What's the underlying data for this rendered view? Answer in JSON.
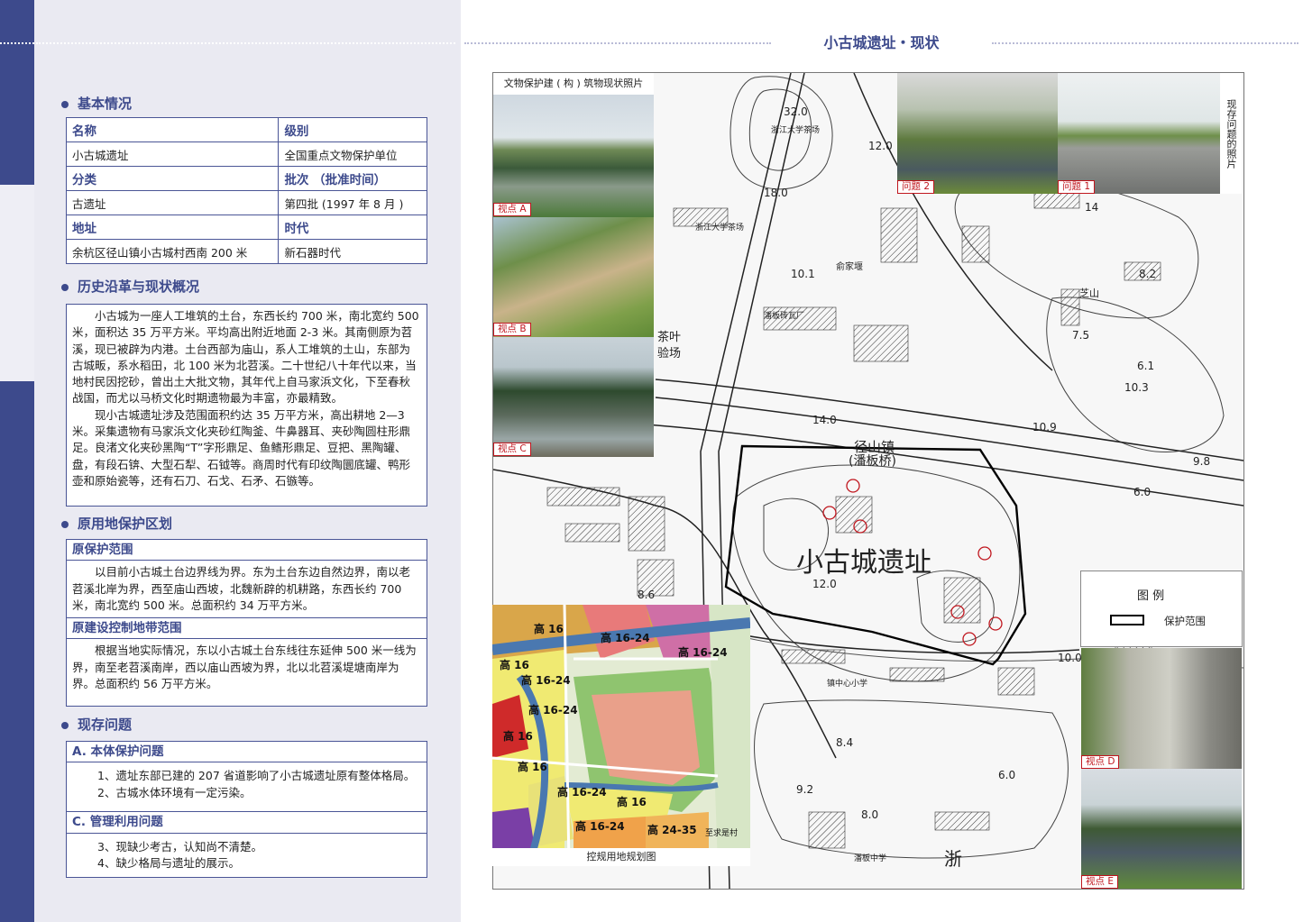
{
  "page": {
    "title": "小古城遗址・现状"
  },
  "sections": {
    "basic": "基本情况",
    "history": "历史沿革与现状概况",
    "zone": "原用地保护区划",
    "problems": "现存问题"
  },
  "basic_table": {
    "name_h": "名称",
    "level_h": "级别",
    "name": "小古城遗址",
    "level": "全国重点文物保护单位",
    "category_h": "分类",
    "batch_h": "批次 （批准时间）",
    "category": "古遗址",
    "batch": "第四批 (1997 年 8 月 )",
    "address_h": "地址",
    "era_h": "时代",
    "address": "余杭区径山镇小古城村西南 200 米",
    "era": "新石器时代"
  },
  "history": {
    "p1": "小古城为一座人工堆筑的土台，东西长约 700 米，南北宽约 500 米，面积达 35 万平方米。平均高出附近地面 2-3 米。其南侧原为苕溪，现已被辟为内港。土台西部为庙山，系人工堆筑的土山，东部为古城畈，系水稻田，北 100 米为北苕溪。二十世纪八十年代以来，当地村民因挖砂，曾出土大批文物，其年代上自马家浜文化，下至春秋战国，而尤以马桥文化时期遗物最为丰富，亦最精致。",
    "p2": "现小古城遗址涉及范围面积约达 35 万平方米，高出耕地 2—3 米。采集遗物有马家浜文化夹砂红陶釜、牛鼻器耳、夹砂陶圆柱形鼎足。良渚文化夹砂黑陶“T”字形鼎足、鱼鳍形鼎足、豆把、黑陶罐、盘，有段石锛、大型石犁、石钺等。商周时代有印纹陶圜底罐、鸭形壶和原始瓷等，还有石刀、石戈、石矛、石镞等。"
  },
  "zone": {
    "protect_h": "原保护范围",
    "protect": "以目前小古城土台边界线为界。东为土台东边自然边界，南以老苕溪北岸为界，西至庙山西坡，北魏新辟的机耕路，东西长约 700 米，南北宽约 500 米。总面积约 34 万平方米。",
    "control_h": "原建设控制地带范围",
    "control": "根据当地实际情况，东以小古城土台东线往东延伸 500 米一线为界，南至老苕溪南岸，西以庙山西坡为界，北以北苕溪堤塘南岸为界。总面积约 56 万平方米。"
  },
  "problems": {
    "a_h": "A. 本体保护问题",
    "a1": "1、遗址东部已建的 207 省道影响了小古城遗址原有整体格局。",
    "a2": "2、古城水体环境有一定污染。",
    "c_h": "C. 管理利用问题",
    "c3": "3、现缺少考古，认知尚不清楚。",
    "c4": "4、缺少格局与遗址的展示。"
  },
  "map": {
    "photo_caption": "文物保护建 ( 构 ) 筑物现状照片",
    "problem_photos_caption": "现存问题的照片",
    "plan_caption": "控规用地规划图",
    "site_label": "小古城遗址",
    "town_label": "径山镇",
    "town_sub": "(潘板桥)",
    "legend_title": "图 例",
    "legend_item": "保护范围",
    "views": [
      "视点 A",
      "视点 B",
      "视点 C",
      "视点 D",
      "视点 E"
    ],
    "issues": [
      "问题 2",
      "问题 1"
    ],
    "places": [
      "浙江大学茶场",
      "浙江大学茶场",
      "俞家堰",
      "芝山",
      "潘板砖瓦厂",
      "茶叶",
      "验场",
      "镇中心小学",
      "潘板中学",
      "浙"
    ],
    "elevations": [
      "32.0",
      "12.0",
      "18.0",
      "10.1",
      "7.5",
      "10.3",
      "14.0",
      "10.9",
      "9.8",
      "6.0",
      "12.0",
      "8.6",
      "10.0",
      "8.4",
      "6.0",
      "9.2",
      "8.0",
      "8.2",
      "14",
      "6.1"
    ],
    "plan_labels": [
      "高 16",
      "高 16-24",
      "高 16-24",
      "高 16",
      "高 16-24",
      "高 16-24",
      "高 16",
      "高 16",
      "高 16-24",
      "高 16",
      "高 16-24",
      "高 24-35",
      "至求是村"
    ]
  }
}
